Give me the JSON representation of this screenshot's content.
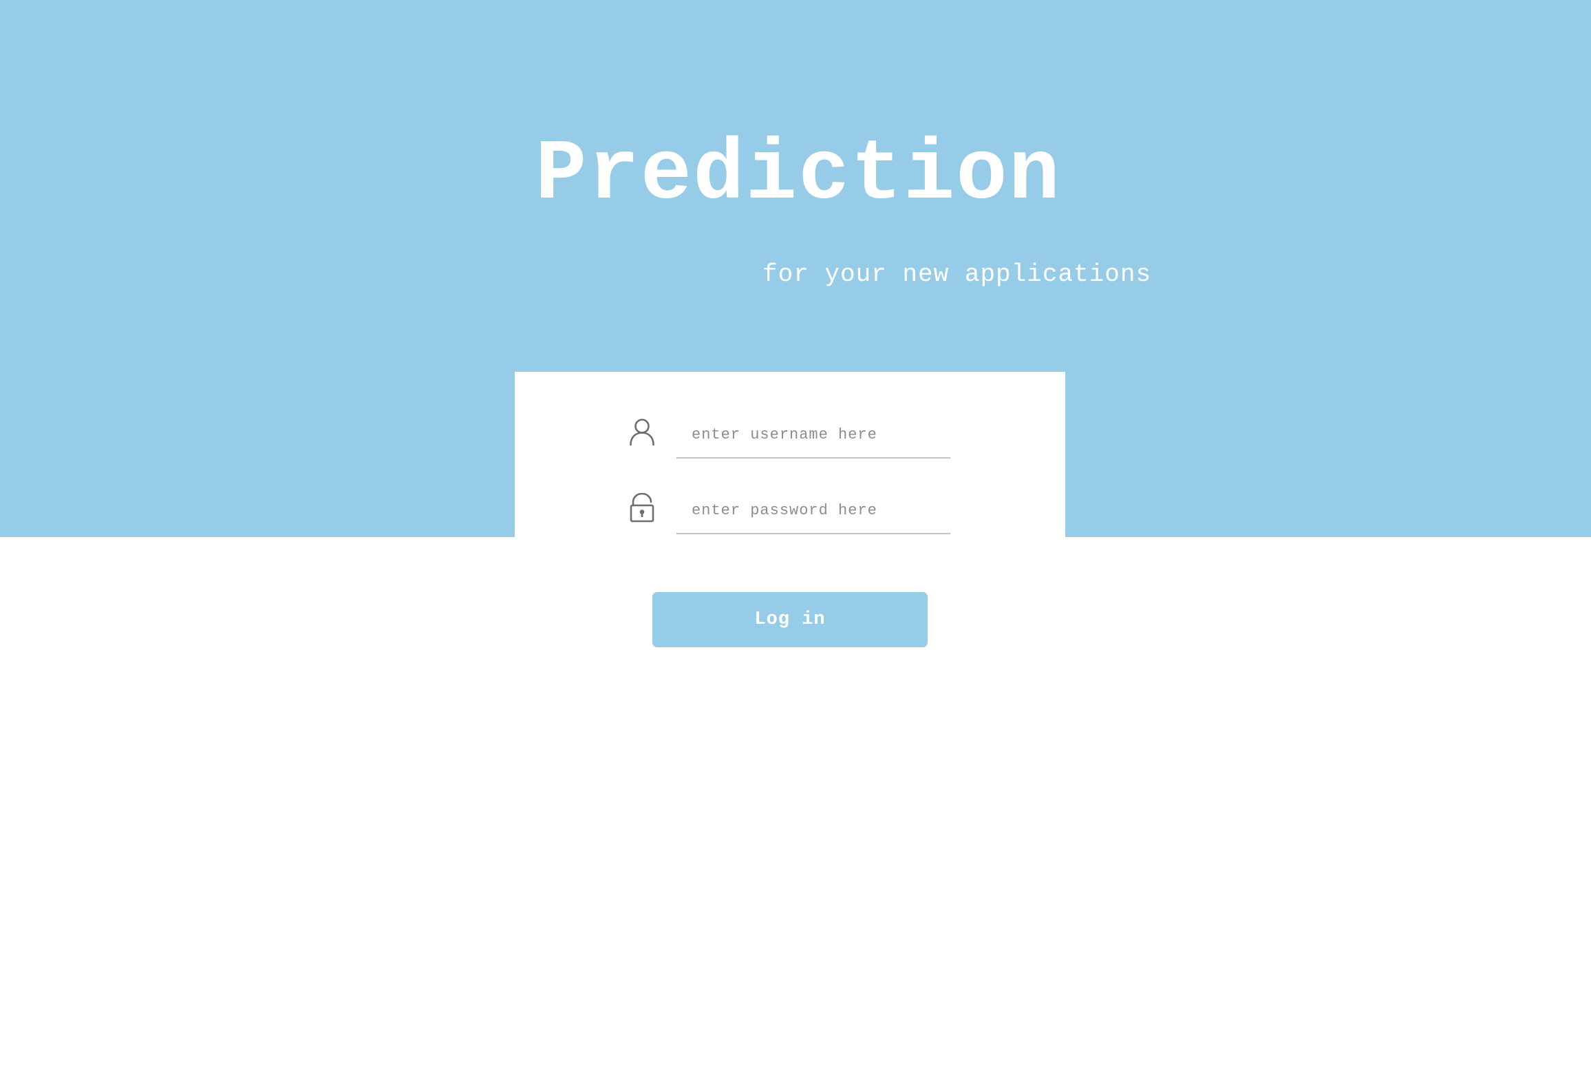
{
  "hero": {
    "title": "Prediction",
    "subtitle": "for your new applications",
    "background_color": "#97cce8"
  },
  "login_form": {
    "username": {
      "icon": "user-icon",
      "placeholder": "enter username here",
      "value": ""
    },
    "password": {
      "icon": "unlocked-padlock-icon",
      "placeholder": "enter password here",
      "value": ""
    },
    "submit_label": "Log in",
    "button_color": "#97cce8"
  }
}
